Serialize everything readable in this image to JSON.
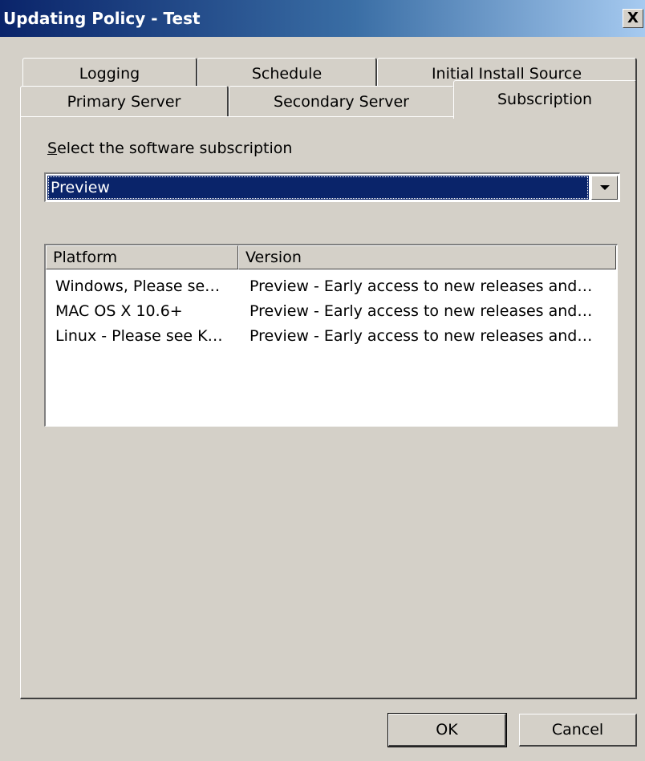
{
  "window": {
    "title": "Updating Policy - Test",
    "close_label": "X"
  },
  "tabs": {
    "row1": [
      {
        "label": "Logging"
      },
      {
        "label": "Schedule"
      },
      {
        "label": "Initial Install Source"
      }
    ],
    "row2": [
      {
        "label": "Primary Server"
      },
      {
        "label": "Secondary Server"
      },
      {
        "label": "Subscription",
        "active": true
      }
    ]
  },
  "subscription": {
    "select_label_accel": "S",
    "select_label_rest": "elect the software subscription",
    "selected_value": "Preview"
  },
  "table": {
    "columns": [
      "Platform",
      "Version"
    ],
    "rows": [
      {
        "platform": "Windows, Please se…",
        "version": "Preview - Early access to new releases and…"
      },
      {
        "platform": "MAC OS X 10.6+",
        "version": "Preview - Early access to new releases and…"
      },
      {
        "platform": "Linux - Please see K…",
        "version": "Preview - Early access to new releases and…"
      }
    ]
  },
  "buttons": {
    "ok": "OK",
    "cancel": "Cancel"
  }
}
